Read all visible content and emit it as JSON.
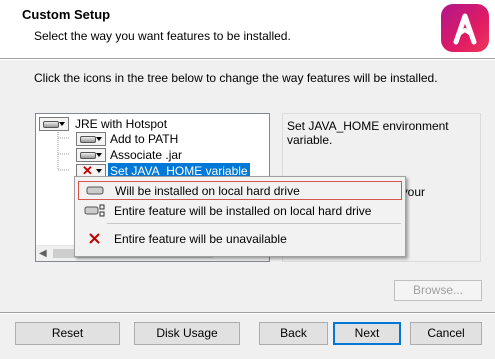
{
  "header": {
    "title": "Custom Setup",
    "subtitle": "Select the way you want features to be installed."
  },
  "instruction": "Click the icons in the tree below to change the way features will be installed.",
  "tree": {
    "root": {
      "label": "JRE with Hotspot",
      "icon": "hard-drive-icon"
    },
    "children": [
      {
        "label": "Add to PATH",
        "icon": "hard-drive-icon"
      },
      {
        "label": "Associate .jar",
        "icon": "hard-drive-icon"
      },
      {
        "label": "Set JAVA_HOME variable",
        "icon": "red-x-icon",
        "selected": true
      }
    ]
  },
  "description": {
    "text": "Set JAVA_HOME environment variable.",
    "extra": "on your"
  },
  "menu": {
    "items": [
      {
        "label": "Will be installed on local hard drive",
        "icon": "hard-drive-icon"
      },
      {
        "label": "Entire feature will be installed on local hard drive",
        "icon": "hard-drive-tree-icon"
      },
      {
        "label": "Entire feature will be unavailable",
        "icon": "red-x-icon"
      }
    ]
  },
  "buttons": {
    "browse": "Browse...",
    "reset": "Reset",
    "disk_usage": "Disk Usage",
    "back": "Back",
    "next": "Next",
    "cancel": "Cancel"
  },
  "colors": {
    "selection": "#0078d7",
    "red_x": "#c00000",
    "logo_gradient": [
      "#b0188c",
      "#f0365a"
    ],
    "highlight_border": "#d9534f"
  }
}
